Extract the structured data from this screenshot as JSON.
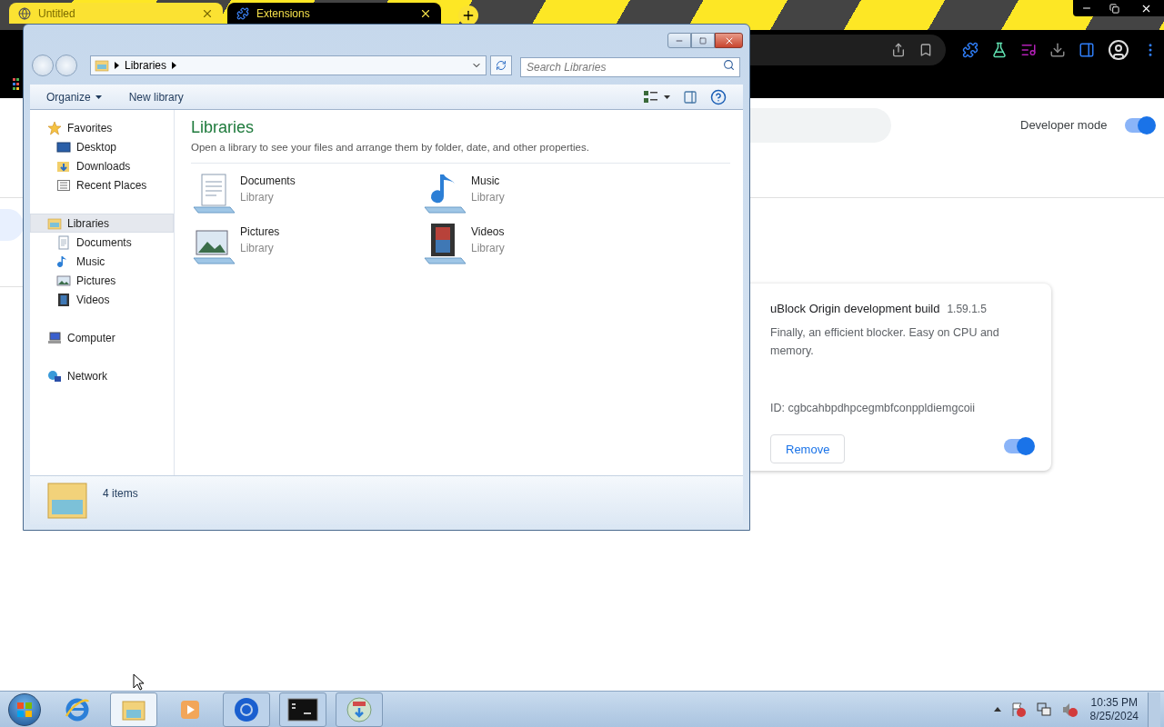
{
  "browser": {
    "tabs": [
      {
        "title": "Untitled",
        "kind": "globe",
        "selected": false
      },
      {
        "title": "Extensions",
        "kind": "puzzle",
        "selected": true
      }
    ]
  },
  "extensions_page": {
    "developer_mode": {
      "label": "Developer mode",
      "on": true
    },
    "card": {
      "name": "uBlock Origin development build",
      "version": "1.59.1.5",
      "description": "Finally, an efficient blocker. Easy on CPU and memory.",
      "id": "ID: cgbcahbpdhpcegmbfconppldiemgcoii",
      "remove_button": "Remove",
      "enabled": true
    }
  },
  "explorer": {
    "breadcrumb": [
      "Libraries"
    ],
    "search": {
      "placeholder": "Search Libraries"
    },
    "toolbar": [
      {
        "label": "Organize",
        "menu": true
      },
      {
        "label": "New library",
        "menu": false
      }
    ],
    "nav": [
      {
        "label": "Favorites",
        "kind": "star",
        "selected": false,
        "children": [
          {
            "label": "Desktop",
            "kind": "desktop",
            "selected": false
          },
          {
            "label": "Downloads",
            "kind": "downloads",
            "selected": false
          },
          {
            "label": "Recent Places",
            "kind": "recent",
            "selected": false
          }
        ]
      },
      {
        "label": "Libraries",
        "kind": "library",
        "selected": true,
        "children": [
          {
            "label": "Documents",
            "kind": "documents",
            "selected": false
          },
          {
            "label": "Music",
            "kind": "music",
            "selected": false
          },
          {
            "label": "Pictures",
            "kind": "pictures",
            "selected": false
          },
          {
            "label": "Videos",
            "kind": "videos",
            "selected": false
          }
        ]
      },
      {
        "label": "Computer",
        "kind": "computer",
        "selected": false
      },
      {
        "label": "Network",
        "kind": "network",
        "selected": false
      }
    ],
    "heading": "Libraries",
    "subtitle": "Open a library to see your files and arrange them by folder, date, and other properties.",
    "items": [
      {
        "name": "Documents",
        "type": "Library",
        "kind": "documents"
      },
      {
        "name": "Music",
        "type": "Library",
        "kind": "music"
      },
      {
        "name": "Pictures",
        "type": "Library",
        "kind": "pictures"
      },
      {
        "name": "Videos",
        "type": "Library",
        "kind": "videos"
      }
    ],
    "status": "4 items"
  },
  "taskbar": {
    "apps": [
      {
        "kind": "ie",
        "running": false,
        "selected": false
      },
      {
        "kind": "explorer",
        "running": true,
        "selected": true
      },
      {
        "kind": "media",
        "running": false,
        "selected": false
      },
      {
        "kind": "chrome",
        "running": true,
        "selected": false
      },
      {
        "kind": "cmd",
        "running": true,
        "selected": false
      },
      {
        "kind": "installer",
        "running": true,
        "selected": false
      }
    ],
    "time": "10:35 PM",
    "date": "8/25/2024"
  }
}
